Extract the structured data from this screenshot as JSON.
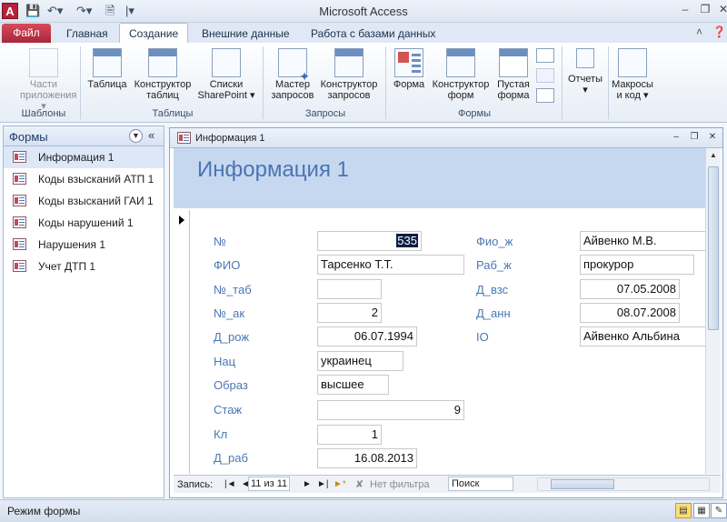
{
  "window": {
    "title": "Microsoft Access",
    "app_icon_letter": "A"
  },
  "quick_access": {
    "save_icon": "save-icon",
    "undo_icon": "undo-icon",
    "redo_icon": "redo-icon",
    "new_icon": "new-document-icon"
  },
  "ribbon_tabs": {
    "file": "Файл",
    "home": "Главная",
    "create": "Создание",
    "external": "Внешние данные",
    "database_tools": "Работа с базами данных"
  },
  "ribbon": {
    "templates": {
      "app_parts_line1": "Части",
      "app_parts_line2": "приложения ▾",
      "group": "Шаблоны"
    },
    "tables": {
      "table": "Таблица",
      "designer_line1": "Конструктор",
      "designer_line2": "таблиц",
      "sharepoint_line1": "Списки",
      "sharepoint_line2": "SharePoint ▾",
      "group": "Таблицы"
    },
    "queries": {
      "wizard_line1": "Мастер",
      "wizard_line2": "запросов",
      "designer_line1": "Конструктор",
      "designer_line2": "запросов",
      "group": "Запросы"
    },
    "forms": {
      "form": "Форма",
      "designer_line1": "Конструктор",
      "designer_line2": "форм",
      "blank_line1": "Пустая",
      "blank_line2": "форма",
      "group": "Формы"
    },
    "reports": {
      "label": "Отчеты",
      "arrow": "▾"
    },
    "macros": {
      "line1": "Макросы",
      "line2": "и код ▾"
    }
  },
  "nav_pane": {
    "title": "Формы",
    "collapse": "«",
    "items": [
      {
        "label": "Информация 1",
        "selected": true
      },
      {
        "label": "Коды взысканий АТП 1",
        "selected": false
      },
      {
        "label": "Коды взысканий ГАИ 1",
        "selected": false
      },
      {
        "label": "Коды нарушений 1",
        "selected": false
      },
      {
        "label": "Нарушения 1",
        "selected": false
      },
      {
        "label": "Учет ДТП 1",
        "selected": false
      }
    ]
  },
  "document": {
    "tab_title": "Информация 1",
    "heading": "Информация 1",
    "fields_left": [
      {
        "label": "№",
        "value": "535"
      },
      {
        "label": "ФИО",
        "value": "Тарсенко Т.Т."
      },
      {
        "label": "№_таб",
        "value": ""
      },
      {
        "label": "№_ак",
        "value": "2"
      },
      {
        "label": "Д_рож",
        "value": "06.07.1994"
      },
      {
        "label": "Нац",
        "value": "украинец"
      },
      {
        "label": "Образ",
        "value": "высшее"
      },
      {
        "label": "Стаж",
        "value": "9"
      },
      {
        "label": "Кл",
        "value": "1"
      },
      {
        "label": "Д_раб",
        "value": "16.08.2013"
      }
    ],
    "fields_right": [
      {
        "label": "Фио_ж",
        "value": "Айвенко М.В."
      },
      {
        "label": "Раб_ж",
        "value": "прокурор"
      },
      {
        "label": "Д_взс",
        "value": "07.05.2008"
      },
      {
        "label": "Д_анн",
        "value": "08.07.2008"
      },
      {
        "label": "IO",
        "value": "Айвенко Альбина"
      }
    ]
  },
  "record_nav": {
    "label": "Запись:",
    "first": "|◄",
    "prev": "◄",
    "position": "11 из 11",
    "next": "►",
    "last": "►|",
    "new": "►*",
    "filter": "Нет фильтра",
    "search": "Поиск"
  },
  "status_bar": {
    "text": "Режим формы"
  }
}
